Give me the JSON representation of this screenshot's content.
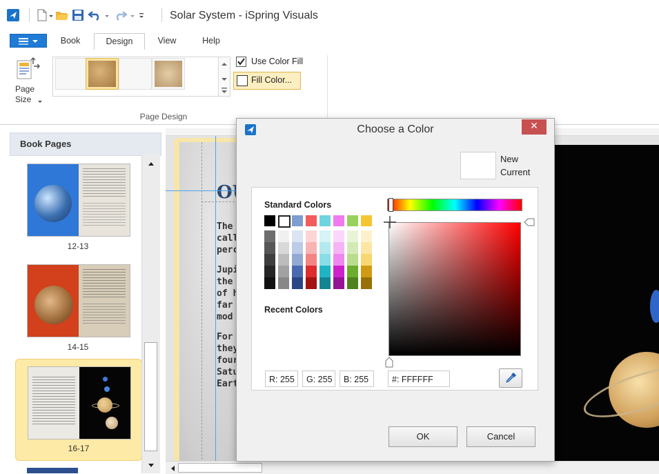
{
  "window": {
    "title": "Solar System - iSpring Visuals"
  },
  "tabs": [
    {
      "label": "Book"
    },
    {
      "label": "Design"
    },
    {
      "label": "View"
    },
    {
      "label": "Help"
    }
  ],
  "ribbon": {
    "page_size_label": "Page\nSize",
    "use_color_fill_label": "Use Color Fill",
    "use_color_fill_checked": true,
    "fill_color_label": "Fill Color...",
    "group_label": "Page Design"
  },
  "book_pages": {
    "title": "Book Pages",
    "items": [
      {
        "label": "12-13"
      },
      {
        "label": "14-15"
      },
      {
        "label": "16-17"
      }
    ]
  },
  "canvas": {
    "visible_heading": "OU",
    "text_fragments": [
      "The",
      "call",
      "perc",
      "Jupi",
      "the",
      "of h",
      "far",
      "mod",
      "For",
      "they",
      "four",
      "Satu",
      "Eart"
    ]
  },
  "dialog": {
    "title": "Choose a Color",
    "new_label": "New",
    "current_label": "Current",
    "standard_colors_label": "Standard Colors",
    "recent_colors_label": "Recent Colors",
    "r_label": "R: 255",
    "g_label": "G: 255",
    "b_label": "B: 255",
    "hex_label": "#: FFFFFF",
    "ok_label": "OK",
    "cancel_label": "Cancel",
    "standard_top_row": [
      "#000000",
      "#ffffff",
      "#7e9dd0",
      "#f25c5c",
      "#6fd3e0",
      "#f07bf0",
      "#98d160",
      "#f3c531"
    ],
    "standard_columns": [
      [
        "#6e6e6e",
        "#575757",
        "#3e3e3e",
        "#262626",
        "#121212"
      ],
      [
        "#f0f0f0",
        "#d8d8d8",
        "#bcbcbc",
        "#a2a2a2",
        "#888888"
      ],
      [
        "#dbe4f3",
        "#bccbe6",
        "#92a9d2",
        "#4a6ab0",
        "#2a4685"
      ],
      [
        "#fcd6d6",
        "#f8b3b3",
        "#f38585",
        "#dd2d2d",
        "#a51212"
      ],
      [
        "#d6f3f6",
        "#b4e9ef",
        "#88dde6",
        "#21b3c2",
        "#138591"
      ],
      [
        "#fad7fa",
        "#f5b5f5",
        "#ee88ee",
        "#cc22cc",
        "#951495"
      ],
      [
        "#e8f4d8",
        "#d3eab6",
        "#b9dd8c",
        "#6cad2e",
        "#4e821c"
      ],
      [
        "#fdf1cd",
        "#fbe6a4",
        "#f8d672",
        "#d09a14",
        "#977108"
      ]
    ]
  }
}
